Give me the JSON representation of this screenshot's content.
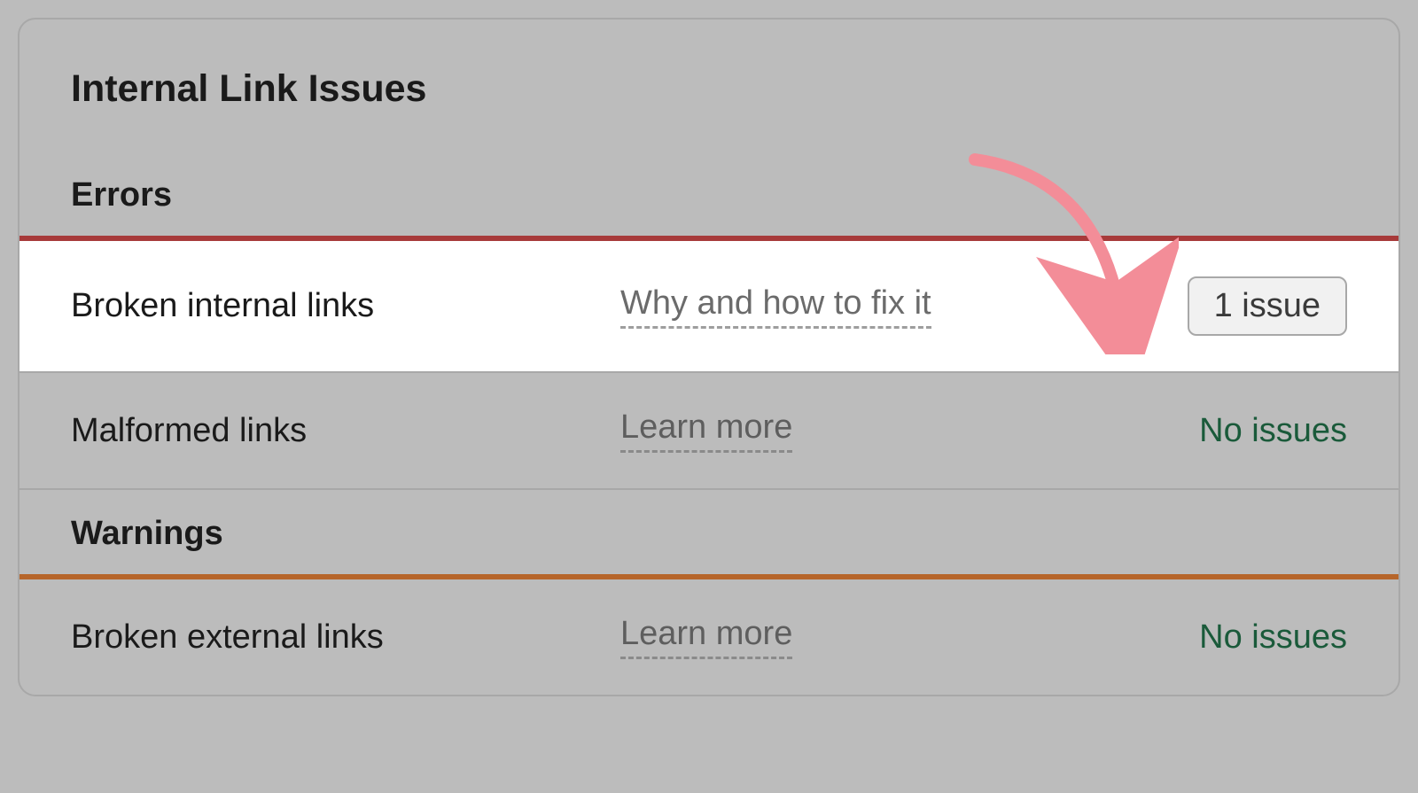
{
  "panel": {
    "title": "Internal Link Issues"
  },
  "sections": {
    "errors": {
      "heading": "Errors",
      "items": [
        {
          "name": "Broken internal links",
          "help": "Why and how to fix it",
          "status_type": "count",
          "status_text": "1 issue"
        },
        {
          "name": "Malformed links",
          "help": "Learn more",
          "status_type": "none",
          "status_text": "No issues"
        }
      ]
    },
    "warnings": {
      "heading": "Warnings",
      "items": [
        {
          "name": "Broken external links",
          "help": "Learn more",
          "status_type": "none",
          "status_text": "No issues"
        }
      ]
    }
  },
  "colors": {
    "errors_divider": "#a73a3a",
    "warnings_divider": "#b6652a",
    "no_issues_text": "#1a5a3a",
    "annotation_arrow": "#f38d98"
  }
}
